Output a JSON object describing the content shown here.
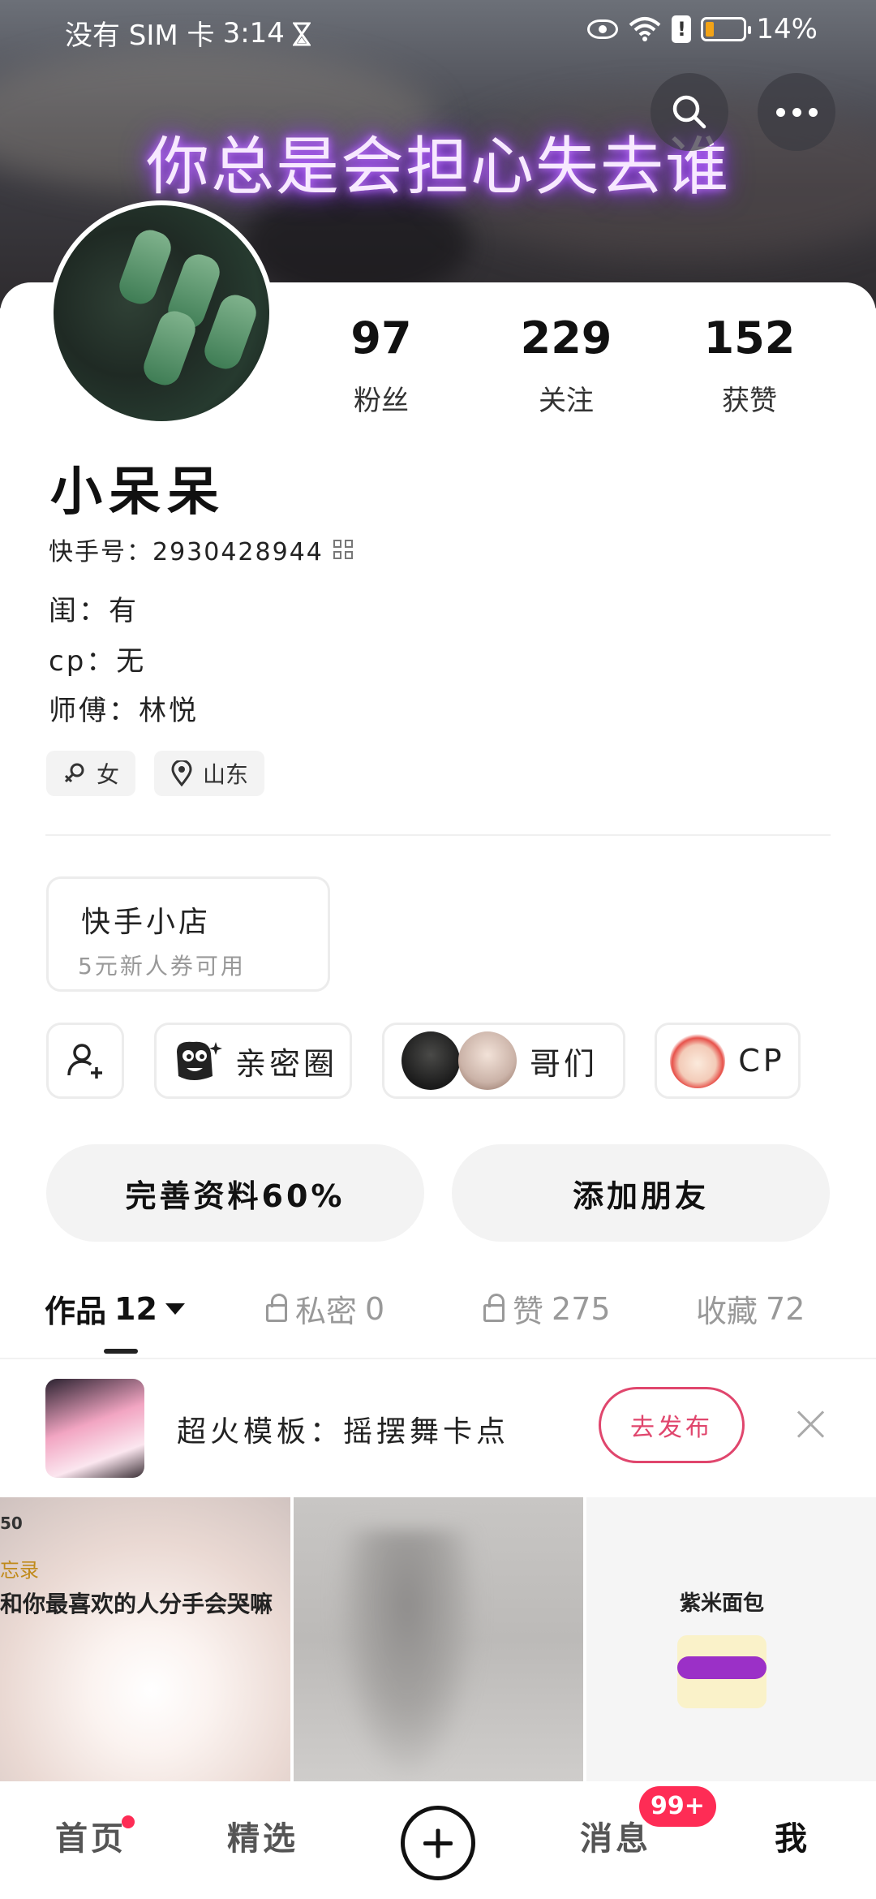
{
  "status_bar": {
    "carrier": "没有 SIM 卡",
    "time": "3:14",
    "battery": "14%"
  },
  "banner": {
    "text": "你总是会担心失去谁"
  },
  "stats": [
    {
      "num": "97",
      "label": "粉丝"
    },
    {
      "num": "229",
      "label": "关注"
    },
    {
      "num": "152",
      "label": "获赞"
    }
  ],
  "profile": {
    "name": "小呆呆",
    "kuaishou_id": "快手号：2930428944",
    "bio": [
      "闺：有",
      "cp：无",
      "师傅：林悦"
    ],
    "tags": {
      "gender": "女",
      "location": "山东"
    }
  },
  "shop": {
    "title": "快手小店",
    "subtitle": "5元新人券可用"
  },
  "social": {
    "intimate": "亲密圈",
    "bros": "哥们",
    "cp": "CP"
  },
  "actions": {
    "complete_profile": "完善资料60%",
    "add_friend": "添加朋友"
  },
  "tabs": [
    {
      "label": "作品",
      "count": "12"
    },
    {
      "label": "私密",
      "count": "0"
    },
    {
      "label": "赞",
      "count": "275"
    },
    {
      "label": "收藏",
      "count": "72"
    }
  ],
  "promo": {
    "text": "超火模板：摇摆舞卡点",
    "button": "去发布"
  },
  "grid": {
    "item1": {
      "status_time": "50",
      "memo": "忘录",
      "text": "和你最喜欢的人分手会哭嘛"
    },
    "item3": {
      "title": "紫米面包"
    }
  },
  "nav": {
    "home": "首页",
    "featured": "精选",
    "messages": "消息",
    "message_badge": "99+",
    "me": "我"
  },
  "colors": {
    "accent": "#fe2c55",
    "publish": "#e0466d",
    "neon": "#c077ff"
  }
}
